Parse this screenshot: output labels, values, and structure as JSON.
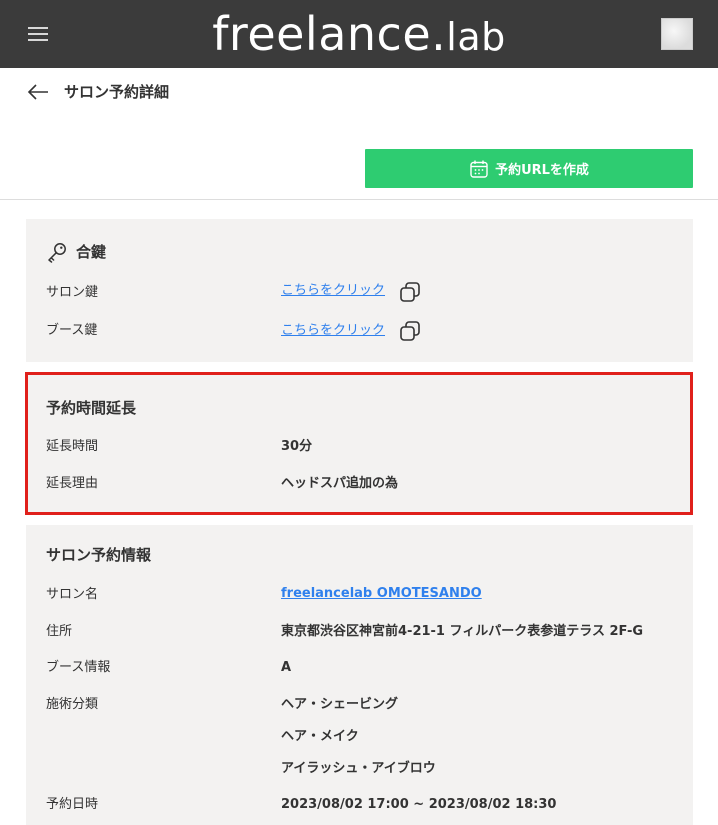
{
  "header": {
    "logo_main": "freelance.",
    "logo_suffix": "lab",
    "menu_icon": "hamburger-icon",
    "avatar_icon": "user-avatar"
  },
  "page": {
    "title": "サロン予約詳細",
    "back_icon": "arrow-left-icon"
  },
  "actions": {
    "create_url_label": "予約URLを作成",
    "create_url_icon": "calendar-icon",
    "button_color": "#2ecc71"
  },
  "keys_card": {
    "title": "合鍵",
    "icon": "key-icon",
    "rows": [
      {
        "label": "サロン鍵",
        "link_text": "こちらをクリック",
        "icon": "copy-icon"
      },
      {
        "label": "ブース鍵",
        "link_text": "こちらをクリック",
        "icon": "copy-icon"
      }
    ]
  },
  "extension_card": {
    "title": "予約時間延長",
    "highlight_color": "#e0201b",
    "rows": [
      {
        "label": "延長時間",
        "value": "30分"
      },
      {
        "label": "延長理由",
        "value": "ヘッドスパ追加の為"
      }
    ]
  },
  "salon_card": {
    "title": "サロン予約情報",
    "salon_name_label": "サロン名",
    "salon_name_value": "freelancelab OMOTESANDO",
    "address_label": "住所",
    "address_value": "東京都渋谷区神宮前4-21-1 フィルパーク表参道テラス 2F-G",
    "booth_label": "ブース情報",
    "booth_value": "A",
    "treatment_label": "施術分類",
    "treatments": [
      "ヘア・シェービング",
      "ヘア・メイク",
      "アイラッシュ・アイブロウ"
    ],
    "datetime_label": "予約日時",
    "datetime_value": "2023/08/02 17:00 ~ 2023/08/02 18:30"
  },
  "colors": {
    "header_bg": "#3b3b3b",
    "card_bg": "#f3f2f1",
    "link": "#2f80ed"
  }
}
